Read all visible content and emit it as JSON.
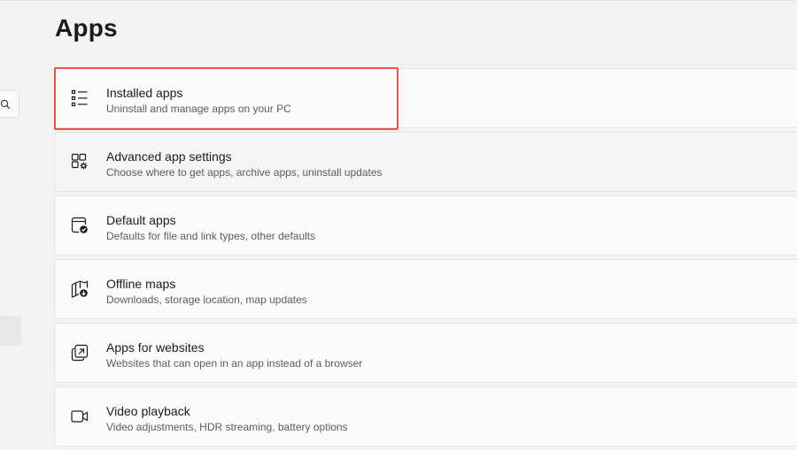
{
  "page": {
    "title": "Apps"
  },
  "items": [
    {
      "title": "Installed apps",
      "subtitle": "Uninstall and manage apps on your PC",
      "icon": "list-icon"
    },
    {
      "title": "Advanced app settings",
      "subtitle": "Choose where to get apps, archive apps, uninstall updates",
      "icon": "app-settings-icon"
    },
    {
      "title": "Default apps",
      "subtitle": "Defaults for file and link types, other defaults",
      "icon": "default-apps-icon"
    },
    {
      "title": "Offline maps",
      "subtitle": "Downloads, storage location, map updates",
      "icon": "map-download-icon"
    },
    {
      "title": "Apps for websites",
      "subtitle": "Websites that can open in an app instead of a browser",
      "icon": "open-in-app-icon"
    },
    {
      "title": "Video playback",
      "subtitle": "Video adjustments, HDR streaming, battery options",
      "icon": "video-camera-icon"
    }
  ],
  "colors": {
    "highlight": "#e5534b",
    "card_bg": "#fbfbfb",
    "page_bg": "#f3f3f3"
  },
  "search": {
    "icon": "search-icon"
  }
}
